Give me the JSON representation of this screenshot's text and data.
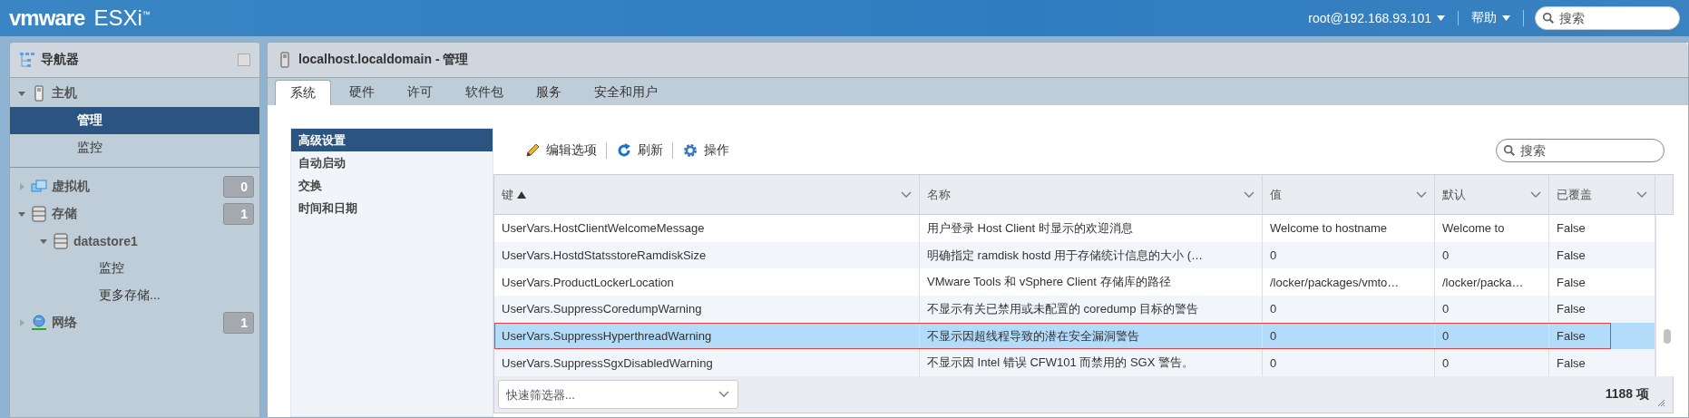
{
  "topbar": {
    "brand": "vmware",
    "product": "ESXi$^{™}$",
    "user_menu": "root@192.168.93.101",
    "help_menu": "帮助",
    "search": {
      "placeholder": "搜索"
    }
  },
  "navigator": {
    "title": "导航器",
    "items": [
      {
        "kind": "host",
        "label": "主机",
        "expanded": true,
        "selected": false,
        "children": [
          {
            "kind": "page",
            "label": "管理",
            "selected": true
          },
          {
            "kind": "page",
            "label": "监控",
            "selected": false
          }
        ]
      },
      {
        "kind": "vm",
        "label": "虚拟机",
        "expanded": false,
        "selected": false,
        "count": "0"
      },
      {
        "kind": "storage",
        "label": "存储",
        "expanded": true,
        "selected": false,
        "count": "1",
        "children": [
          {
            "kind": "datastore",
            "label": "datastore1",
            "expanded": true,
            "selected": false,
            "children": [
              {
                "kind": "page",
                "label": "监控",
                "selected": false
              },
              {
                "kind": "page",
                "label": "更多存储...",
                "selected": false
              }
            ]
          }
        ]
      },
      {
        "kind": "network",
        "label": "网络",
        "expanded": false,
        "selected": false,
        "count": "1"
      }
    ]
  },
  "main": {
    "title": "localhost.localdomain - 管理",
    "tabs": [
      {
        "label": "系统",
        "selected": true
      },
      {
        "label": "硬件",
        "selected": false
      },
      {
        "label": "许可",
        "selected": false
      },
      {
        "label": "软件包",
        "selected": false
      },
      {
        "label": "服务",
        "selected": false
      },
      {
        "label": "安全和用户",
        "selected": false
      }
    ],
    "side_menu": [
      {
        "label": "高级设置",
        "selected": true
      },
      {
        "label": "自动启动",
        "selected": false
      },
      {
        "label": "交换",
        "selected": false
      },
      {
        "label": "时间和日期",
        "selected": false
      }
    ],
    "toolbar": [
      {
        "kind": "edit",
        "label": "编辑选项"
      },
      {
        "kind": "refresh",
        "label": "刷新"
      },
      {
        "kind": "actions",
        "label": "操作"
      }
    ],
    "search": {
      "placeholder": "搜索"
    },
    "table": {
      "columns": [
        {
          "label": "键",
          "sorted_ascending": true
        },
        {
          "label": "名称",
          "sorted_ascending": false
        },
        {
          "label": "值",
          "sorted_ascending": false
        },
        {
          "label": "默认",
          "sorted_ascending": false
        },
        {
          "label": "已覆盖",
          "sorted_ascending": false
        }
      ],
      "rows": [
        {
          "cells": [
            "UserVars.HostClientWelcomeMessage",
            "用户登录 Host Client 时显示的欢迎消息",
            "Welcome to hostname",
            "Welcome to",
            "False"
          ],
          "selected": false,
          "outlined": false
        },
        {
          "cells": [
            "UserVars.HostdStatsstoreRamdiskSize",
            "明确指定 ramdisk hostd 用于存储统计信息的大小 (…",
            "0",
            "0",
            "False"
          ],
          "selected": false,
          "outlined": false
        },
        {
          "cells": [
            "UserVars.ProductLockerLocation",
            "VMware Tools 和 vSphere Client 存储库的路径",
            "/locker/packages/vmto…",
            "/locker/packa…",
            "False"
          ],
          "selected": false,
          "outlined": false
        },
        {
          "cells": [
            "UserVars.SuppressCoredumpWarning",
            "不显示有关已禁用或未配置的 coredump 目标的警告",
            "0",
            "0",
            "False"
          ],
          "selected": false,
          "outlined": false
        },
        {
          "cells": [
            "UserVars.SuppressHyperthreadWarning",
            "不显示因超线程导致的潜在安全漏洞警告",
            "0",
            "0",
            "False"
          ],
          "selected": true,
          "outlined": true
        },
        {
          "cells": [
            "UserVars.SuppressSgxDisabledWarning",
            "不显示因 Intel 错误 CFW101 而禁用的 SGX 警告。",
            "0",
            "0",
            "False"
          ],
          "selected": false,
          "outlined": false
        }
      ],
      "quick_filter": {
        "placeholder": "快速筛选器..."
      },
      "count": "1188 项"
    }
  }
}
